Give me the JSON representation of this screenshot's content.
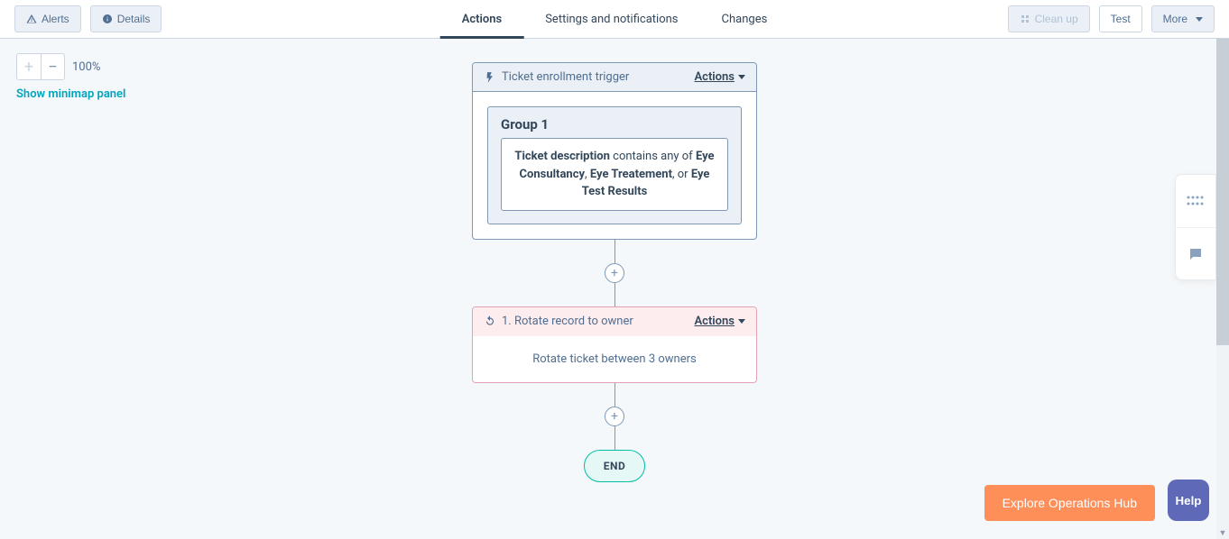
{
  "header": {
    "alerts": "Alerts",
    "details": "Details",
    "cleanup": "Clean up",
    "test": "Test",
    "more": "More"
  },
  "tabs": {
    "actions": "Actions",
    "settings": "Settings and notifications",
    "changes": "Changes"
  },
  "zoom": {
    "level": "100%",
    "minimap": "Show minimap panel"
  },
  "trigger": {
    "title": "Ticket enrollment trigger",
    "actions": "Actions",
    "group_label": "Group 1",
    "filter_field": "Ticket description",
    "filter_mid": " contains any of ",
    "filter_v1": "Eye Consultancy",
    "filter_sep1": ", ",
    "filter_v2": "Eye Treatement",
    "filter_sep2": ", or ",
    "filter_v3": "Eye Test Results"
  },
  "action": {
    "title": "1. Rotate record to owner",
    "actions": "Actions",
    "body": "Rotate ticket between 3 owners"
  },
  "end": "END",
  "cta": {
    "explore": "Explore Operations Hub",
    "help": "Help"
  }
}
